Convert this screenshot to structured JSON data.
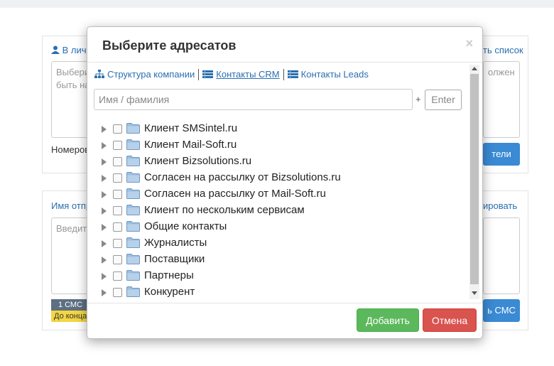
{
  "background": {
    "panel1": {
      "header_left": "В личн",
      "header_right": "ть список",
      "textarea_text": "Выбери\nбыть на",
      "textarea_right_text": "олжен",
      "numbers_label": "Номеров",
      "button_label": "тели"
    },
    "panel2": {
      "sender_label": "Имя отпр",
      "header_right": "ировать",
      "textarea_text": "Введите",
      "sms_count": "1 СМС",
      "sms_warning": "До конца",
      "button_label": "ь СМС"
    }
  },
  "modal": {
    "title": "Выберите адресатов",
    "close_symbol": "×",
    "tabs": [
      {
        "label": "Структура компании",
        "icon": "sitemap-icon"
      },
      {
        "label": "Контакты CRM",
        "icon": "list-icon"
      },
      {
        "label": "Контакты Leads",
        "icon": "list-icon"
      }
    ],
    "search": {
      "placeholder": "Имя / фамилия",
      "value": ""
    },
    "plus": "+",
    "enter_label": "Enter",
    "groups": [
      "Клиент SMSintel.ru",
      "Клиент Mail-Soft.ru",
      "Клиент Bizsolutions.ru",
      "Согласен на рассылку от Bizsolutions.ru",
      "Согласен на рассылку от Mail-Soft.ru",
      "Клиент по нескольким сервисам",
      "Общие контакты",
      "Журналисты",
      "Поставщики",
      "Партнеры",
      "Конкурент"
    ],
    "add_label": "Добавить",
    "cancel_label": "Отмена"
  },
  "colors": {
    "link": "#2a6fb0",
    "success": "#5cb85c",
    "danger": "#d9534f",
    "primary": "#3a8ad4",
    "folder": "#8fb4d9"
  }
}
